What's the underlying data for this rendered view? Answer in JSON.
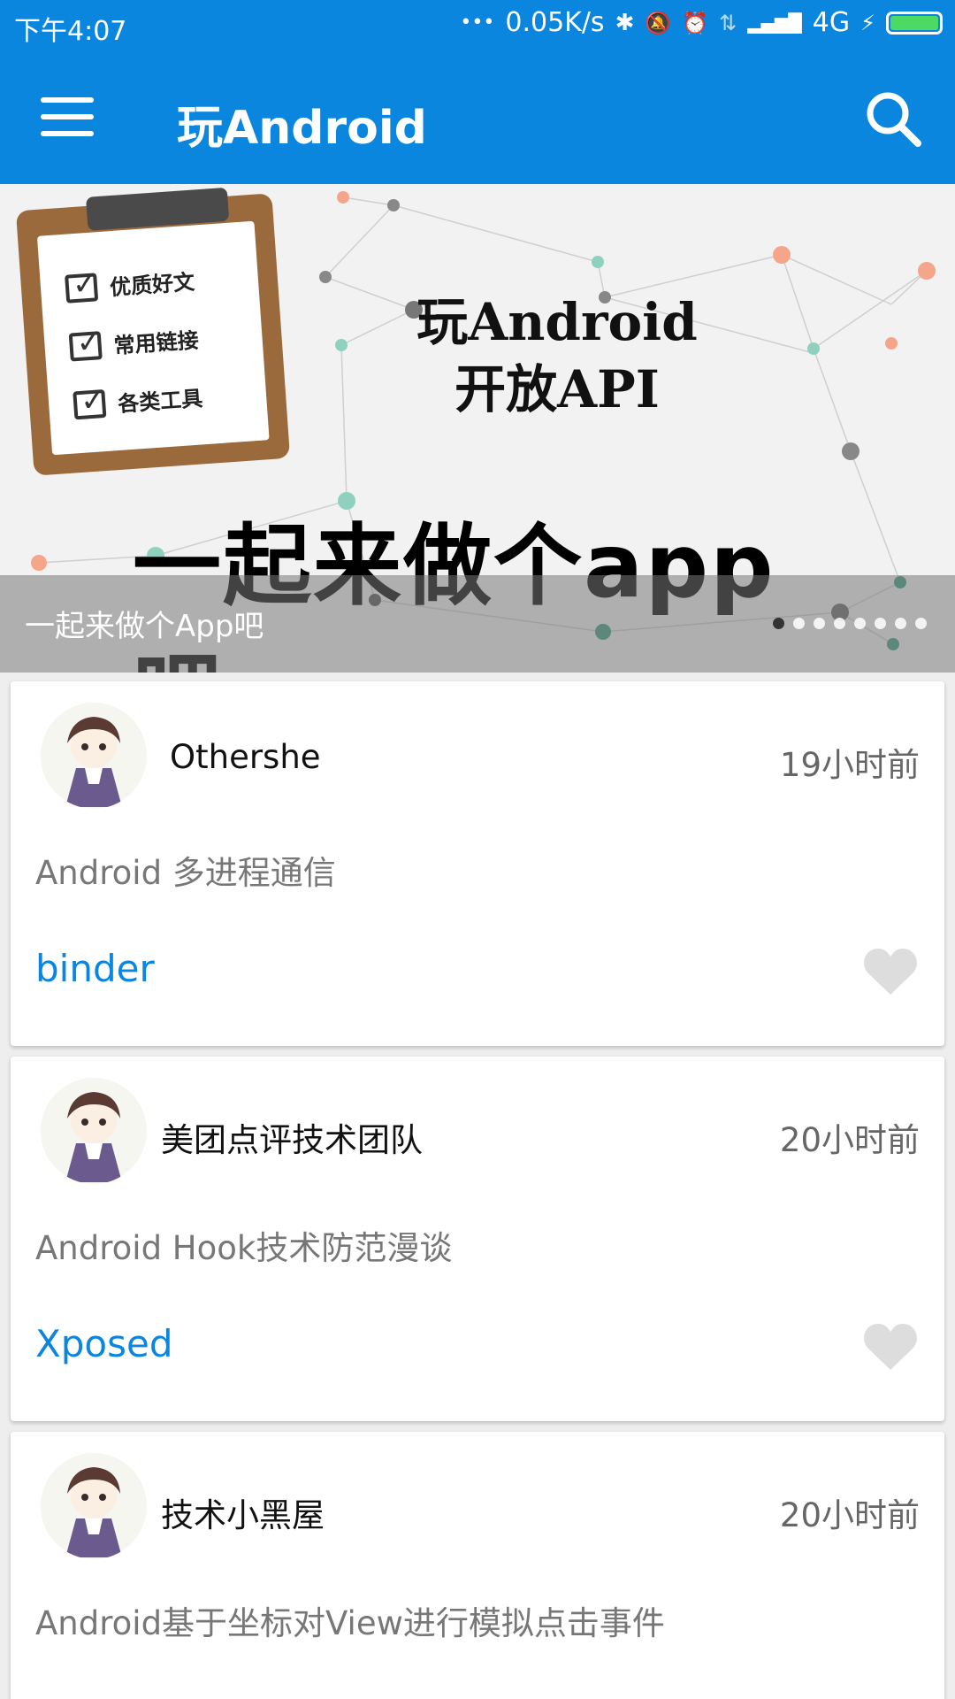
{
  "status_bar": {
    "time": "下午4:07",
    "more": "•••",
    "net_speed": "0.05K/s",
    "bluetooth": "✱",
    "mute": "🔕",
    "alarm": "⏰",
    "data": "⇅",
    "signal": "▂▄▆█",
    "network": "4G",
    "charging": "⚡",
    "battery_icon": "battery-icon"
  },
  "appbar": {
    "title": "玩Android",
    "menu_icon": "hamburger-menu-icon",
    "search_icon": "search-icon"
  },
  "banner": {
    "clipboard_items": [
      "优质好文",
      "常用链接",
      "各类工具"
    ],
    "headline_line1": "玩Android",
    "headline_line2": "开放API",
    "slogan": "一起来做个app吧",
    "caption": "一起来做个App吧",
    "page_count": 8,
    "active_page": 1
  },
  "articles": [
    {
      "author": "Othershe",
      "time": "19小时前",
      "title": "Android 多进程通信",
      "tag": "binder",
      "liked": false
    },
    {
      "author": "美团点评技术团队",
      "time": "20小时前",
      "title": "Android Hook技术防范漫谈",
      "tag": "Xposed",
      "liked": false
    },
    {
      "author": "技术小黑屋",
      "time": "20小时前",
      "title": "Android基于坐标对View进行模拟点击事件",
      "tag": "",
      "liked": false
    }
  ],
  "colors": {
    "primary": "#0b86df",
    "tag": "#0b86df",
    "like_inactive": "#dddddd"
  }
}
